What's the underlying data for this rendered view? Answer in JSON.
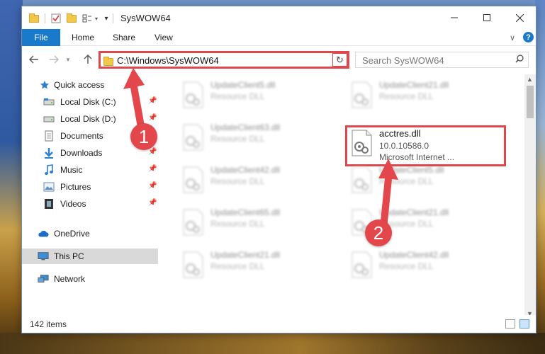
{
  "window": {
    "title": "SysWOW64"
  },
  "ribbon": {
    "tabs": [
      "File",
      "Home",
      "Share",
      "View"
    ]
  },
  "address": {
    "path": "C:\\Windows\\SysWOW64"
  },
  "search": {
    "placeholder": "Search SysWOW64"
  },
  "nav": {
    "items": [
      {
        "label": "Quick access",
        "icon": "star-icon",
        "pinned": false
      },
      {
        "label": "Local Disk (C:)",
        "icon": "drive-icon",
        "pinned": true
      },
      {
        "label": "Local Disk (D:)",
        "icon": "drive-icon",
        "pinned": true
      },
      {
        "label": "Documents",
        "icon": "documents-icon",
        "pinned": true
      },
      {
        "label": "Downloads",
        "icon": "downloads-icon",
        "pinned": true
      },
      {
        "label": "Music",
        "icon": "music-icon",
        "pinned": true
      },
      {
        "label": "Pictures",
        "icon": "pictures-icon",
        "pinned": true
      },
      {
        "label": "Videos",
        "icon": "videos-icon",
        "pinned": true
      },
      {
        "label": "OneDrive",
        "icon": "cloud-icon",
        "pinned": false
      },
      {
        "label": "This PC",
        "icon": "computer-icon",
        "pinned": false,
        "selected": true
      },
      {
        "label": "Network",
        "icon": "network-icon",
        "pinned": false
      }
    ]
  },
  "files": {
    "left": [
      {
        "name": "UpdateClient5.dll",
        "desc": "Resource DLL"
      },
      {
        "name": "UpdateClient63.dll",
        "desc": "Resource DLL"
      },
      {
        "name": "UpdateClient42.dll",
        "desc": "Resource DLL"
      },
      {
        "name": "UpdateClient65.dll",
        "desc": "Resource DLL"
      },
      {
        "name": "UpdateClient21.dll",
        "desc": "Resource DLL"
      }
    ],
    "right": [
      {
        "name": "UpdateClient21.dll",
        "desc": "Resource DLL"
      },
      {
        "name": "UpdateClient5.dll",
        "desc": "Resource DLL"
      },
      {
        "name": "UpdateClient21.dll",
        "desc": "Resource DLL"
      },
      {
        "name": "UpdateClient42.dll",
        "desc": "Resource DLL"
      }
    ],
    "selected": {
      "name": "acctres.dll",
      "version": "10.0.10586.0",
      "desc": "Microsoft Internet ..."
    }
  },
  "status": {
    "count": "142 items"
  },
  "annotations": {
    "step1": "1",
    "step2": "2",
    "color": "#e3474c"
  }
}
